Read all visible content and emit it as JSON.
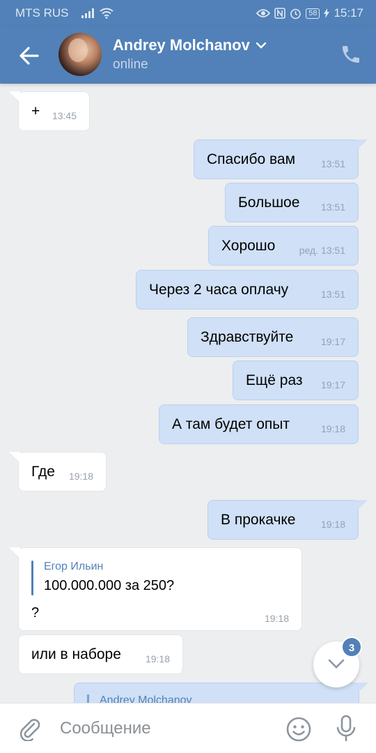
{
  "status_bar": {
    "carrier": "MTS RUS",
    "battery": "58",
    "time": "15:17"
  },
  "header": {
    "name": "Andrey Molchanov",
    "status": "online"
  },
  "messages": [
    {
      "dir": "in",
      "text": "+",
      "time": "13:45"
    },
    {
      "dir": "out",
      "text": "Спасибо вам",
      "time": "13:51"
    },
    {
      "dir": "out",
      "text": "Большое",
      "time": "13:51"
    },
    {
      "dir": "out",
      "text": "Хорошо",
      "time": "ред. 13:51"
    },
    {
      "dir": "out",
      "text": "Через 2 часа оплачу",
      "time": "13:51"
    },
    {
      "dir": "out",
      "text": "Здравствуйте",
      "time": "19:17"
    },
    {
      "dir": "out",
      "text": "Ещё раз",
      "time": "19:17"
    },
    {
      "dir": "out",
      "text": "А там будет опыт",
      "time": "19:18"
    },
    {
      "dir": "in",
      "text": "Где",
      "time": "19:18"
    },
    {
      "dir": "out",
      "text": "В прокачке",
      "time": "19:18"
    },
    {
      "dir": "in",
      "text": "или в наборе",
      "time": "19:18"
    }
  ],
  "reply_message": {
    "quoted_author": "Егор Ильин",
    "quoted_text": "100.000.000 за 250?",
    "text": "?",
    "time": "19:18"
  },
  "partial_message": {
    "quoted_author": "Andrey Molchanov"
  },
  "unread_badge": "3",
  "composer": {
    "placeholder": "Сообщение"
  },
  "icons": {
    "back": "arrow-left-icon",
    "dropdown": "chevron-down-icon",
    "call": "phone-icon",
    "scroll_down": "chevron-down-icon",
    "attach": "paperclip-icon",
    "emoji": "smiley-icon",
    "mic": "microphone-icon"
  },
  "colors": {
    "accent": "#5181b8",
    "incoming_bubble": "#ffffff",
    "outgoing_bubble": "#cfe0f7",
    "background": "#edeef0"
  }
}
